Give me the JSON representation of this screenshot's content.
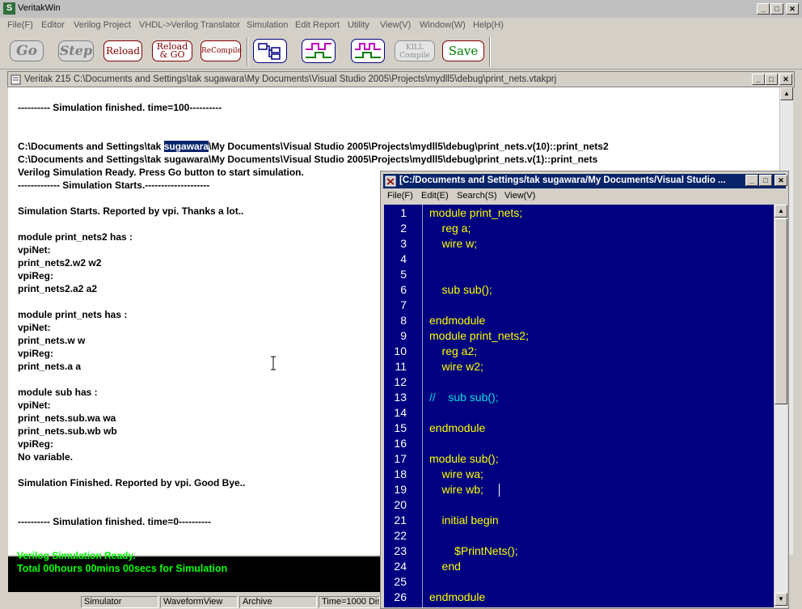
{
  "app": {
    "title": "VeritakWin",
    "icon_letter": "S"
  },
  "window_buttons": {
    "minimize": "_",
    "maximize": "□",
    "close": "✕"
  },
  "menu": [
    "File(F)",
    "Editor",
    "Verilog Project",
    "VHDL->Verilog Translator",
    "Simulation",
    "Edit Report",
    "Utility",
    "View(V)",
    "Window(W)",
    "Help(H)"
  ],
  "toolbar": {
    "go": "Go",
    "step": "Step",
    "reload": "Reload",
    "reload_go_1": "Reload",
    "reload_go_2": "& GO",
    "recompile": "ReCompile",
    "kill_1": "KILL",
    "kill_2": "Compile",
    "save": "Save",
    "hierarchy_icon": "hierarchy-icon",
    "waveform_icon": "waveform-icon",
    "waveform2_icon": "waveform-multi-icon"
  },
  "mdi": {
    "title": "Veritak 215 C:\\Documents and Settings\\tak sugawara\\My Documents\\Visual Studio 2005\\Projects\\mydll5\\debug\\print_nets.vtakprj"
  },
  "log": {
    "lines": [
      "---------- Simulation finished. time=100----------",
      "",
      "",
      "C:\\Documents and Settings\\tak |sugawara|\\My Documents\\Visual Studio 2005\\Projects\\mydll5\\debug\\print_nets.v(10)::print_nets2",
      "C:\\Documents and Settings\\tak sugawara\\My Documents\\Visual Studio 2005\\Projects\\mydll5\\debug\\print_nets.v(1)::print_nets",
      "Verilog Simulation Ready. Press Go button to start simulation.",
      "------------- Simulation Starts.--------------------",
      "",
      "Simulation Starts. Reported by vpi. Thanks a lot..",
      "",
      "module print_nets2 has :",
      "        vpiNet:",
      "                print_nets2.w2 w2",
      "        vpiReg:",
      "                print_nets2.a2 a2",
      "",
      "module print_nets has :",
      "        vpiNet:",
      "                print_nets.w w",
      "        vpiReg:",
      "                print_nets.a a",
      "",
      "module sub has :",
      "        vpiNet:",
      "                print_nets.sub.wa wa",
      "                print_nets.sub.wb wb",
      "        vpiReg:",
      "                No variable.",
      "",
      "Simulation Finished. Reported by vpi. Good Bye..",
      "",
      "",
      "---------- Simulation finished. time=0----------"
    ]
  },
  "status": {
    "line1": "Verilog Simulation Ready.",
    "line2": "Total  00hours 00mins 00secs for Simulation",
    "text_color": "#00ff00"
  },
  "statusbar": [
    "Simulator",
    "WaveformView",
    "Archive",
    "Time=1000 Dis"
  ],
  "editor": {
    "title": "[C:/Documents and Settings/tak sugawara/My Documents/Visual Studio ...",
    "menu": [
      "File(F)",
      "Edit(E)",
      "Search(S)",
      "View(V)"
    ],
    "background": "#000080",
    "lines": [
      {
        "n": "1",
        "text": "module print_nets;",
        "type": "code"
      },
      {
        "n": "2",
        "text": "    reg a;",
        "type": "code"
      },
      {
        "n": "3",
        "text": "    wire w;",
        "type": "code"
      },
      {
        "n": "4",
        "text": "",
        "type": "code"
      },
      {
        "n": "5",
        "text": "",
        "type": "code"
      },
      {
        "n": "6",
        "text": "    sub sub();",
        "type": "code"
      },
      {
        "n": "7",
        "text": "",
        "type": "code"
      },
      {
        "n": "8",
        "text": "endmodule",
        "type": "code"
      },
      {
        "n": "9",
        "text": "module print_nets2;",
        "type": "code"
      },
      {
        "n": "10",
        "text": "    reg a2;",
        "type": "code"
      },
      {
        "n": "11",
        "text": "    wire w2;",
        "type": "code"
      },
      {
        "n": "12",
        "text": "",
        "type": "code"
      },
      {
        "n": "13",
        "text": "//    sub sub();",
        "type": "comment"
      },
      {
        "n": "14",
        "text": "",
        "type": "code"
      },
      {
        "n": "15",
        "text": "endmodule",
        "type": "code"
      },
      {
        "n": "16",
        "text": "",
        "type": "code"
      },
      {
        "n": "17",
        "text": "module sub();",
        "type": "code"
      },
      {
        "n": "18",
        "text": "    wire wa;",
        "type": "code"
      },
      {
        "n": "19",
        "text": "    wire wb;",
        "type": "code"
      },
      {
        "n": "20",
        "text": "",
        "type": "code"
      },
      {
        "n": "21",
        "text": "    initial begin",
        "type": "code"
      },
      {
        "n": "22",
        "text": "",
        "type": "code"
      },
      {
        "n": "23",
        "text": "        $PrintNets();",
        "type": "code"
      },
      {
        "n": "24",
        "text": "    end",
        "type": "code"
      },
      {
        "n": "25",
        "text": "",
        "type": "code"
      },
      {
        "n": "26",
        "text": "endmodule",
        "type": "code"
      }
    ]
  }
}
